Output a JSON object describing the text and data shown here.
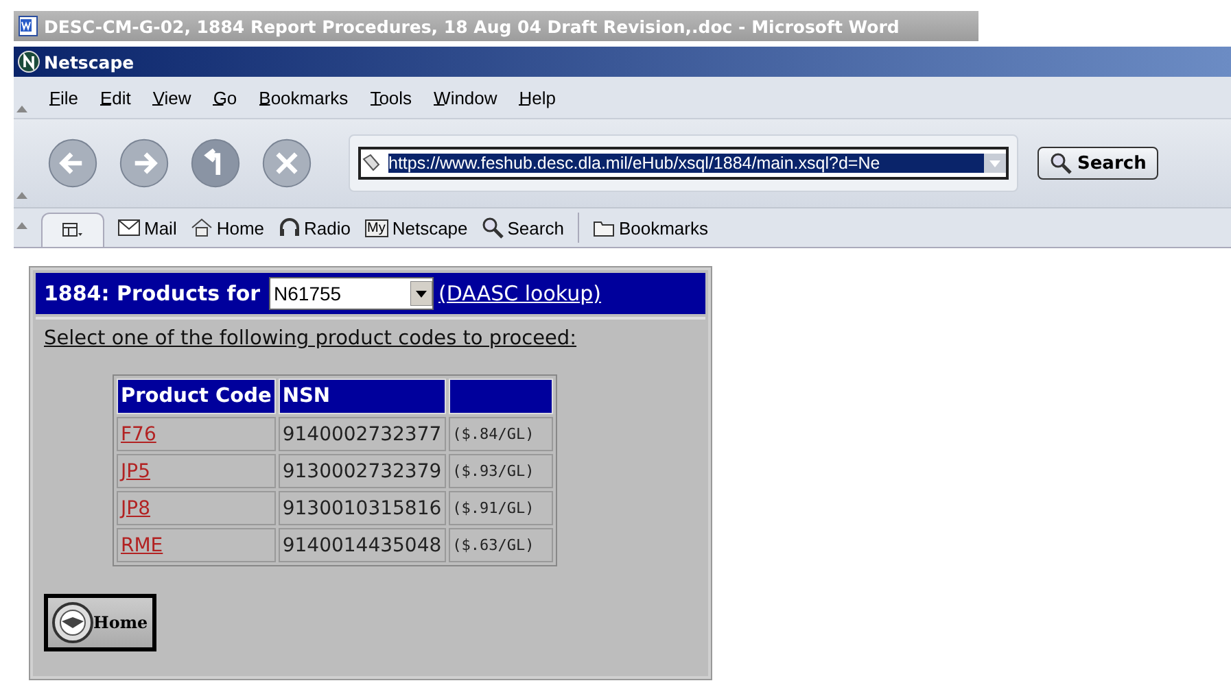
{
  "word_window": {
    "title": "DESC-CM-G-02, 1884 Report Procedures, 18 Aug 04 Draft Revision,.doc - Microsoft Word"
  },
  "browser": {
    "title": "Netscape",
    "menu": [
      {
        "label": "File"
      },
      {
        "label": "Edit"
      },
      {
        "label": "View"
      },
      {
        "label": "Go"
      },
      {
        "label": "Bookmarks"
      },
      {
        "label": "Tools"
      },
      {
        "label": "Window"
      },
      {
        "label": "Help"
      }
    ],
    "nav_buttons": [
      {
        "kind": "back",
        "disabled": true
      },
      {
        "kind": "forward",
        "disabled": true
      },
      {
        "kind": "reload",
        "disabled": false
      },
      {
        "kind": "stop",
        "disabled": true
      }
    ],
    "address": {
      "value": "https://www.feshub.desc.dla.mil/eHub/xsql/1884/main.xsql?d=Ne"
    },
    "search_button": "Search",
    "personal_toolbar": [
      {
        "kind": "mail",
        "label": "Mail"
      },
      {
        "kind": "home",
        "label": "Home"
      },
      {
        "kind": "radio",
        "label": "Radio"
      },
      {
        "kind": "my",
        "label": "Netscape",
        "icon_text": "My"
      },
      {
        "kind": "search",
        "label": "Search"
      },
      {
        "kind": "folder",
        "label": "Bookmarks"
      }
    ]
  },
  "page": {
    "heading": "1884: Products for",
    "dodaac": "N61755",
    "lookup_link": "(DAASC lookup)",
    "instruction": "Select one of the following product codes to proceed:",
    "table": {
      "columns": [
        "Product Code",
        "NSN"
      ],
      "rows": [
        {
          "code": "F76",
          "nsn": "9140002732377",
          "price": "($.84/GL)"
        },
        {
          "code": "JP5",
          "nsn": "9130002732379",
          "price": "($.93/GL)"
        },
        {
          "code": "JP8",
          "nsn": "9130010315816",
          "price": "($.91/GL)"
        },
        {
          "code": "RME",
          "nsn": "9140014435048",
          "price": "($.63/GL)"
        }
      ]
    },
    "home_button": "Home"
  }
}
